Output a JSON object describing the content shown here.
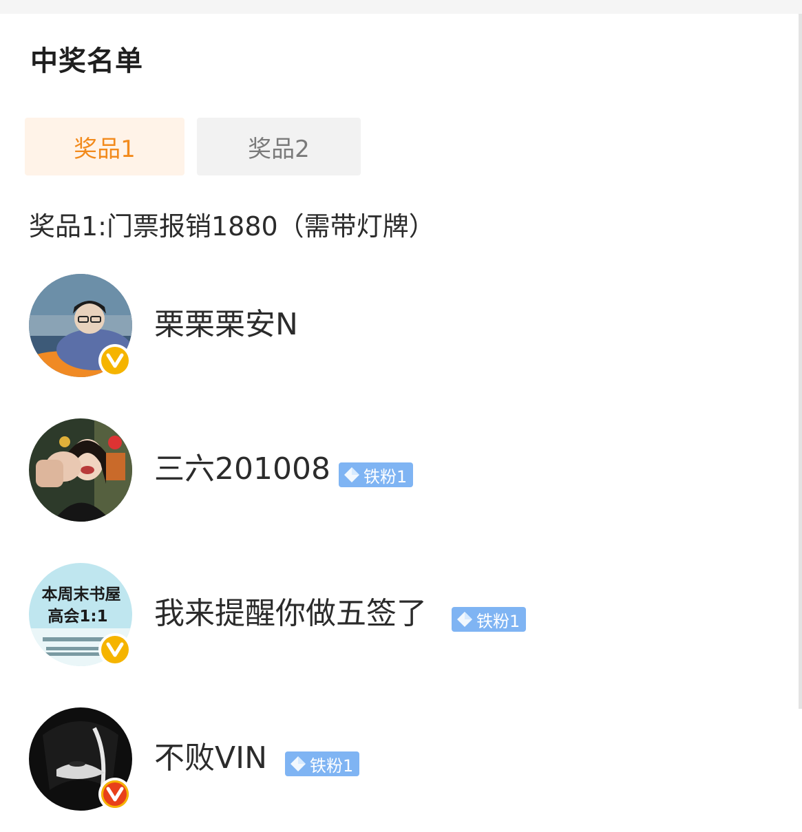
{
  "header": {
    "title": "中奖名单"
  },
  "tabs": [
    {
      "label": "奖品1",
      "active": true
    },
    {
      "label": "奖品2",
      "active": false
    }
  ],
  "prize_description": "奖品1:门票报销1880（需带灯牌）",
  "colors": {
    "accent_orange": "#f28a1c",
    "fan_badge_blue": "#7fb4f3",
    "verified_gold": "#f5b400",
    "verified_red": "#e8401a"
  },
  "winners": [
    {
      "name": "栗栗栗安N",
      "verified": "gold",
      "fan_badge": null
    },
    {
      "name": "三六201008",
      "verified": null,
      "fan_badge": "铁粉1"
    },
    {
      "name": "我来提醒你做五签了",
      "verified": "gold",
      "fan_badge": "铁粉1",
      "avatar_text": [
        "本周末书屋",
        "高会1:1"
      ]
    },
    {
      "name": "不败VIN",
      "verified": "red",
      "fan_badge": "铁粉1"
    }
  ]
}
